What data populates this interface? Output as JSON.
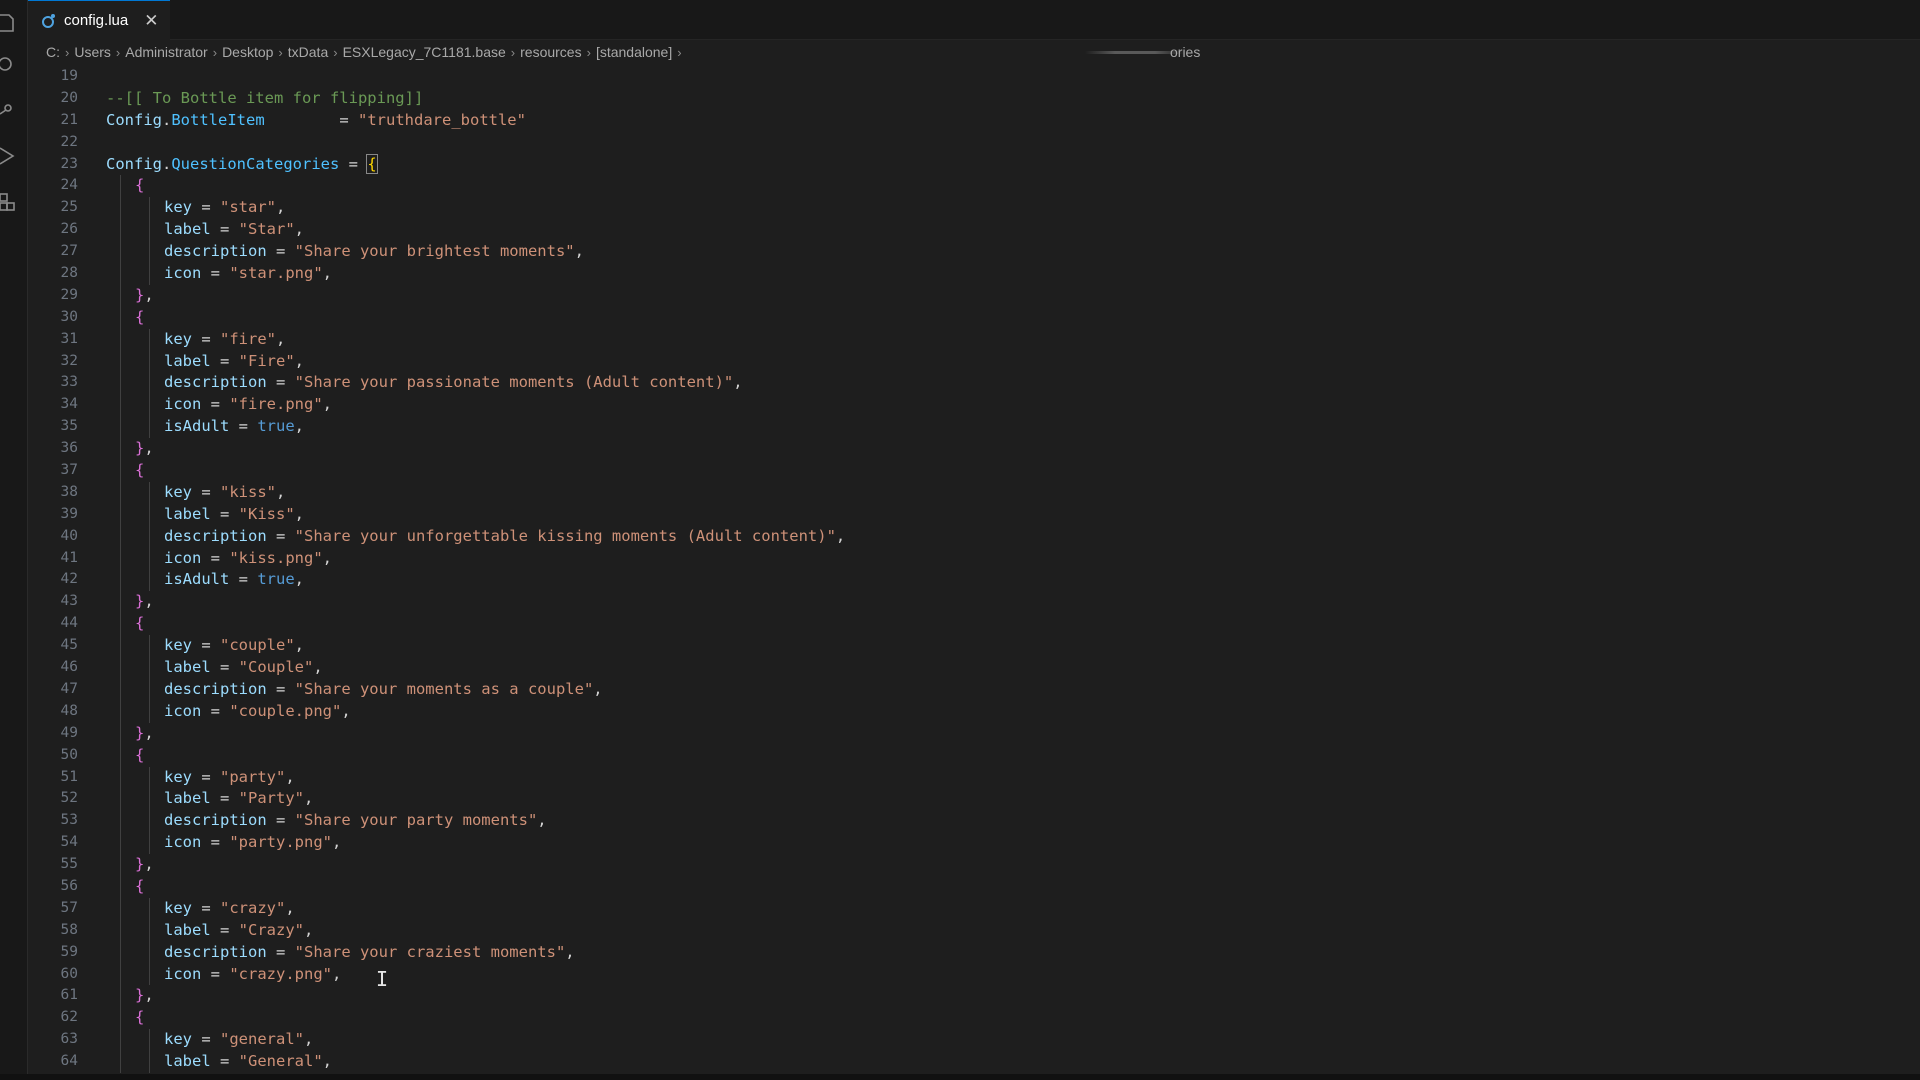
{
  "window": {
    "tab": {
      "filename": "config.lua",
      "close_glyph": "✕",
      "icon": "lua-file-icon"
    }
  },
  "breadcrumb": {
    "segments": [
      "C:",
      "Users",
      "Administrator",
      "Desktop",
      "txData",
      "ESXLegacy_7C1181.base",
      "resources",
      "[standalone]"
    ],
    "trailing_text": "ories"
  },
  "activity_bar": {
    "icons": [
      "explorer-icon",
      "search-icon",
      "source-control-icon",
      "run-debug-icon",
      "extensions-icon"
    ]
  },
  "editor": {
    "lines": [
      {
        "n": "19",
        "tokens": []
      },
      {
        "n": "20",
        "tokens": [
          {
            "c": "t-comment",
            "t": "--[[ To Bottle item for flipping]]"
          }
        ]
      },
      {
        "n": "21",
        "tokens": [
          {
            "c": "t-var",
            "t": "Config"
          },
          {
            "c": "t-op",
            "t": "."
          },
          {
            "c": "t-prop",
            "t": "BottleItem"
          },
          {
            "c": "t-op",
            "t": "        = "
          },
          {
            "c": "t-str",
            "t": "\"truthdare_bottle\""
          }
        ]
      },
      {
        "n": "22",
        "tokens": []
      },
      {
        "n": "23",
        "tokens": [
          {
            "c": "t-var",
            "t": "Config"
          },
          {
            "c": "t-op",
            "t": "."
          },
          {
            "c": "t-prop",
            "t": "QuestionCategories"
          },
          {
            "c": "t-op",
            "t": " = "
          },
          {
            "c": "t-b1 t-bracket-hl",
            "t": "{"
          }
        ]
      },
      {
        "n": "24",
        "indent": 1,
        "tokens": [
          {
            "c": "t-b2",
            "t": "{"
          }
        ]
      },
      {
        "n": "25",
        "indent": 2,
        "tokens": [
          {
            "c": "t-var",
            "t": "key"
          },
          {
            "c": "t-op",
            "t": " = "
          },
          {
            "c": "t-str",
            "t": "\"star\""
          },
          {
            "c": "t-op",
            "t": ","
          }
        ]
      },
      {
        "n": "26",
        "indent": 2,
        "tokens": [
          {
            "c": "t-var",
            "t": "label"
          },
          {
            "c": "t-op",
            "t": " = "
          },
          {
            "c": "t-str",
            "t": "\"Star\""
          },
          {
            "c": "t-op",
            "t": ","
          }
        ]
      },
      {
        "n": "27",
        "indent": 2,
        "tokens": [
          {
            "c": "t-var",
            "t": "description"
          },
          {
            "c": "t-op",
            "t": " = "
          },
          {
            "c": "t-str",
            "t": "\"Share your brightest moments\""
          },
          {
            "c": "t-op",
            "t": ","
          }
        ]
      },
      {
        "n": "28",
        "indent": 2,
        "tokens": [
          {
            "c": "t-var",
            "t": "icon"
          },
          {
            "c": "t-op",
            "t": " = "
          },
          {
            "c": "t-str",
            "t": "\"star.png\""
          },
          {
            "c": "t-op",
            "t": ","
          }
        ]
      },
      {
        "n": "29",
        "indent": 1,
        "tokens": [
          {
            "c": "t-b2",
            "t": "}"
          },
          {
            "c": "t-op",
            "t": ","
          }
        ]
      },
      {
        "n": "30",
        "indent": 1,
        "tokens": [
          {
            "c": "t-b2",
            "t": "{"
          }
        ]
      },
      {
        "n": "31",
        "indent": 2,
        "tokens": [
          {
            "c": "t-var",
            "t": "key"
          },
          {
            "c": "t-op",
            "t": " = "
          },
          {
            "c": "t-str",
            "t": "\"fire\""
          },
          {
            "c": "t-op",
            "t": ","
          }
        ]
      },
      {
        "n": "32",
        "indent": 2,
        "tokens": [
          {
            "c": "t-var",
            "t": "label"
          },
          {
            "c": "t-op",
            "t": " = "
          },
          {
            "c": "t-str",
            "t": "\"Fire\""
          },
          {
            "c": "t-op",
            "t": ","
          }
        ]
      },
      {
        "n": "33",
        "indent": 2,
        "tokens": [
          {
            "c": "t-var",
            "t": "description"
          },
          {
            "c": "t-op",
            "t": " = "
          },
          {
            "c": "t-str",
            "t": "\"Share your passionate moments (Adult content)\""
          },
          {
            "c": "t-op",
            "t": ","
          }
        ]
      },
      {
        "n": "34",
        "indent": 2,
        "tokens": [
          {
            "c": "t-var",
            "t": "icon"
          },
          {
            "c": "t-op",
            "t": " = "
          },
          {
            "c": "t-str",
            "t": "\"fire.png\""
          },
          {
            "c": "t-op",
            "t": ","
          }
        ]
      },
      {
        "n": "35",
        "indent": 2,
        "tokens": [
          {
            "c": "t-var",
            "t": "isAdult"
          },
          {
            "c": "t-op",
            "t": " = "
          },
          {
            "c": "t-bool",
            "t": "true"
          },
          {
            "c": "t-op",
            "t": ","
          }
        ]
      },
      {
        "n": "36",
        "indent": 1,
        "tokens": [
          {
            "c": "t-b2",
            "t": "}"
          },
          {
            "c": "t-op",
            "t": ","
          }
        ]
      },
      {
        "n": "37",
        "indent": 1,
        "tokens": [
          {
            "c": "t-b2",
            "t": "{"
          }
        ]
      },
      {
        "n": "38",
        "indent": 2,
        "tokens": [
          {
            "c": "t-var",
            "t": "key"
          },
          {
            "c": "t-op",
            "t": " = "
          },
          {
            "c": "t-str",
            "t": "\"kiss\""
          },
          {
            "c": "t-op",
            "t": ","
          }
        ]
      },
      {
        "n": "39",
        "indent": 2,
        "tokens": [
          {
            "c": "t-var",
            "t": "label"
          },
          {
            "c": "t-op",
            "t": " = "
          },
          {
            "c": "t-str",
            "t": "\"Kiss\""
          },
          {
            "c": "t-op",
            "t": ","
          }
        ]
      },
      {
        "n": "40",
        "indent": 2,
        "tokens": [
          {
            "c": "t-var",
            "t": "description"
          },
          {
            "c": "t-op",
            "t": " = "
          },
          {
            "c": "t-str",
            "t": "\"Share your unforgettable kissing moments (Adult content)\""
          },
          {
            "c": "t-op",
            "t": ","
          }
        ]
      },
      {
        "n": "41",
        "indent": 2,
        "tokens": [
          {
            "c": "t-var",
            "t": "icon"
          },
          {
            "c": "t-op",
            "t": " = "
          },
          {
            "c": "t-str",
            "t": "\"kiss.png\""
          },
          {
            "c": "t-op",
            "t": ","
          }
        ]
      },
      {
        "n": "42",
        "indent": 2,
        "tokens": [
          {
            "c": "t-var",
            "t": "isAdult"
          },
          {
            "c": "t-op",
            "t": " = "
          },
          {
            "c": "t-bool",
            "t": "true"
          },
          {
            "c": "t-op",
            "t": ","
          }
        ]
      },
      {
        "n": "43",
        "indent": 1,
        "tokens": [
          {
            "c": "t-b2",
            "t": "}"
          },
          {
            "c": "t-op",
            "t": ","
          }
        ]
      },
      {
        "n": "44",
        "indent": 1,
        "tokens": [
          {
            "c": "t-b2",
            "t": "{"
          }
        ]
      },
      {
        "n": "45",
        "indent": 2,
        "tokens": [
          {
            "c": "t-var",
            "t": "key"
          },
          {
            "c": "t-op",
            "t": " = "
          },
          {
            "c": "t-str",
            "t": "\"couple\""
          },
          {
            "c": "t-op",
            "t": ","
          }
        ]
      },
      {
        "n": "46",
        "indent": 2,
        "tokens": [
          {
            "c": "t-var",
            "t": "label"
          },
          {
            "c": "t-op",
            "t": " = "
          },
          {
            "c": "t-str",
            "t": "\"Couple\""
          },
          {
            "c": "t-op",
            "t": ","
          }
        ]
      },
      {
        "n": "47",
        "indent": 2,
        "tokens": [
          {
            "c": "t-var",
            "t": "description"
          },
          {
            "c": "t-op",
            "t": " = "
          },
          {
            "c": "t-str",
            "t": "\"Share your moments as a couple\""
          },
          {
            "c": "t-op",
            "t": ","
          }
        ]
      },
      {
        "n": "48",
        "indent": 2,
        "tokens": [
          {
            "c": "t-var",
            "t": "icon"
          },
          {
            "c": "t-op",
            "t": " = "
          },
          {
            "c": "t-str",
            "t": "\"couple.png\""
          },
          {
            "c": "t-op",
            "t": ","
          }
        ]
      },
      {
        "n": "49",
        "indent": 1,
        "tokens": [
          {
            "c": "t-b2",
            "t": "}"
          },
          {
            "c": "t-op",
            "t": ","
          }
        ]
      },
      {
        "n": "50",
        "indent": 1,
        "tokens": [
          {
            "c": "t-b2",
            "t": "{"
          }
        ]
      },
      {
        "n": "51",
        "indent": 2,
        "tokens": [
          {
            "c": "t-var",
            "t": "key"
          },
          {
            "c": "t-op",
            "t": " = "
          },
          {
            "c": "t-str",
            "t": "\"party\""
          },
          {
            "c": "t-op",
            "t": ","
          }
        ]
      },
      {
        "n": "52",
        "indent": 2,
        "tokens": [
          {
            "c": "t-var",
            "t": "label"
          },
          {
            "c": "t-op",
            "t": " = "
          },
          {
            "c": "t-str",
            "t": "\"Party\""
          },
          {
            "c": "t-op",
            "t": ","
          }
        ]
      },
      {
        "n": "53",
        "indent": 2,
        "tokens": [
          {
            "c": "t-var",
            "t": "description"
          },
          {
            "c": "t-op",
            "t": " = "
          },
          {
            "c": "t-str",
            "t": "\"Share your party moments\""
          },
          {
            "c": "t-op",
            "t": ","
          }
        ]
      },
      {
        "n": "54",
        "indent": 2,
        "tokens": [
          {
            "c": "t-var",
            "t": "icon"
          },
          {
            "c": "t-op",
            "t": " = "
          },
          {
            "c": "t-str",
            "t": "\"party.png\""
          },
          {
            "c": "t-op",
            "t": ","
          }
        ]
      },
      {
        "n": "55",
        "indent": 1,
        "tokens": [
          {
            "c": "t-b2",
            "t": "}"
          },
          {
            "c": "t-op",
            "t": ","
          }
        ]
      },
      {
        "n": "56",
        "indent": 1,
        "tokens": [
          {
            "c": "t-b2",
            "t": "{"
          }
        ]
      },
      {
        "n": "57",
        "indent": 2,
        "tokens": [
          {
            "c": "t-var",
            "t": "key"
          },
          {
            "c": "t-op",
            "t": " = "
          },
          {
            "c": "t-str",
            "t": "\"crazy\""
          },
          {
            "c": "t-op",
            "t": ","
          }
        ]
      },
      {
        "n": "58",
        "indent": 2,
        "tokens": [
          {
            "c": "t-var",
            "t": "label"
          },
          {
            "c": "t-op",
            "t": " = "
          },
          {
            "c": "t-str",
            "t": "\"Crazy\""
          },
          {
            "c": "t-op",
            "t": ","
          }
        ]
      },
      {
        "n": "59",
        "indent": 2,
        "tokens": [
          {
            "c": "t-var",
            "t": "description"
          },
          {
            "c": "t-op",
            "t": " = "
          },
          {
            "c": "t-str",
            "t": "\"Share your craziest moments\""
          },
          {
            "c": "t-op",
            "t": ","
          }
        ]
      },
      {
        "n": "60",
        "indent": 2,
        "tokens": [
          {
            "c": "t-var",
            "t": "icon"
          },
          {
            "c": "t-op",
            "t": " = "
          },
          {
            "c": "t-str",
            "t": "\"crazy.png\""
          },
          {
            "c": "t-op",
            "t": ","
          }
        ]
      },
      {
        "n": "61",
        "indent": 1,
        "tokens": [
          {
            "c": "t-b2",
            "t": "}"
          },
          {
            "c": "t-op",
            "t": ","
          }
        ]
      },
      {
        "n": "62",
        "indent": 1,
        "tokens": [
          {
            "c": "t-b2",
            "t": "{"
          }
        ]
      },
      {
        "n": "63",
        "indent": 2,
        "tokens": [
          {
            "c": "t-var",
            "t": "key"
          },
          {
            "c": "t-op",
            "t": " = "
          },
          {
            "c": "t-str",
            "t": "\"general\""
          },
          {
            "c": "t-op",
            "t": ","
          }
        ]
      },
      {
        "n": "64",
        "indent": 2,
        "tokens": [
          {
            "c": "t-var",
            "t": "label"
          },
          {
            "c": "t-op",
            "t": " = "
          },
          {
            "c": "t-str",
            "t": "\"General\""
          },
          {
            "c": "t-op",
            "t": ","
          }
        ]
      }
    ],
    "mouse_cursor": "I"
  },
  "colors": {
    "background": "#1e1e1e",
    "comment": "#6a9955",
    "string": "#ce9178",
    "keyword_bool": "#569cd6",
    "variable": "#9cdcfe",
    "property": "#4fc1ff",
    "bracket_outer": "#ffd700",
    "bracket_inner": "#da70d6",
    "line_number": "#6e7681"
  }
}
